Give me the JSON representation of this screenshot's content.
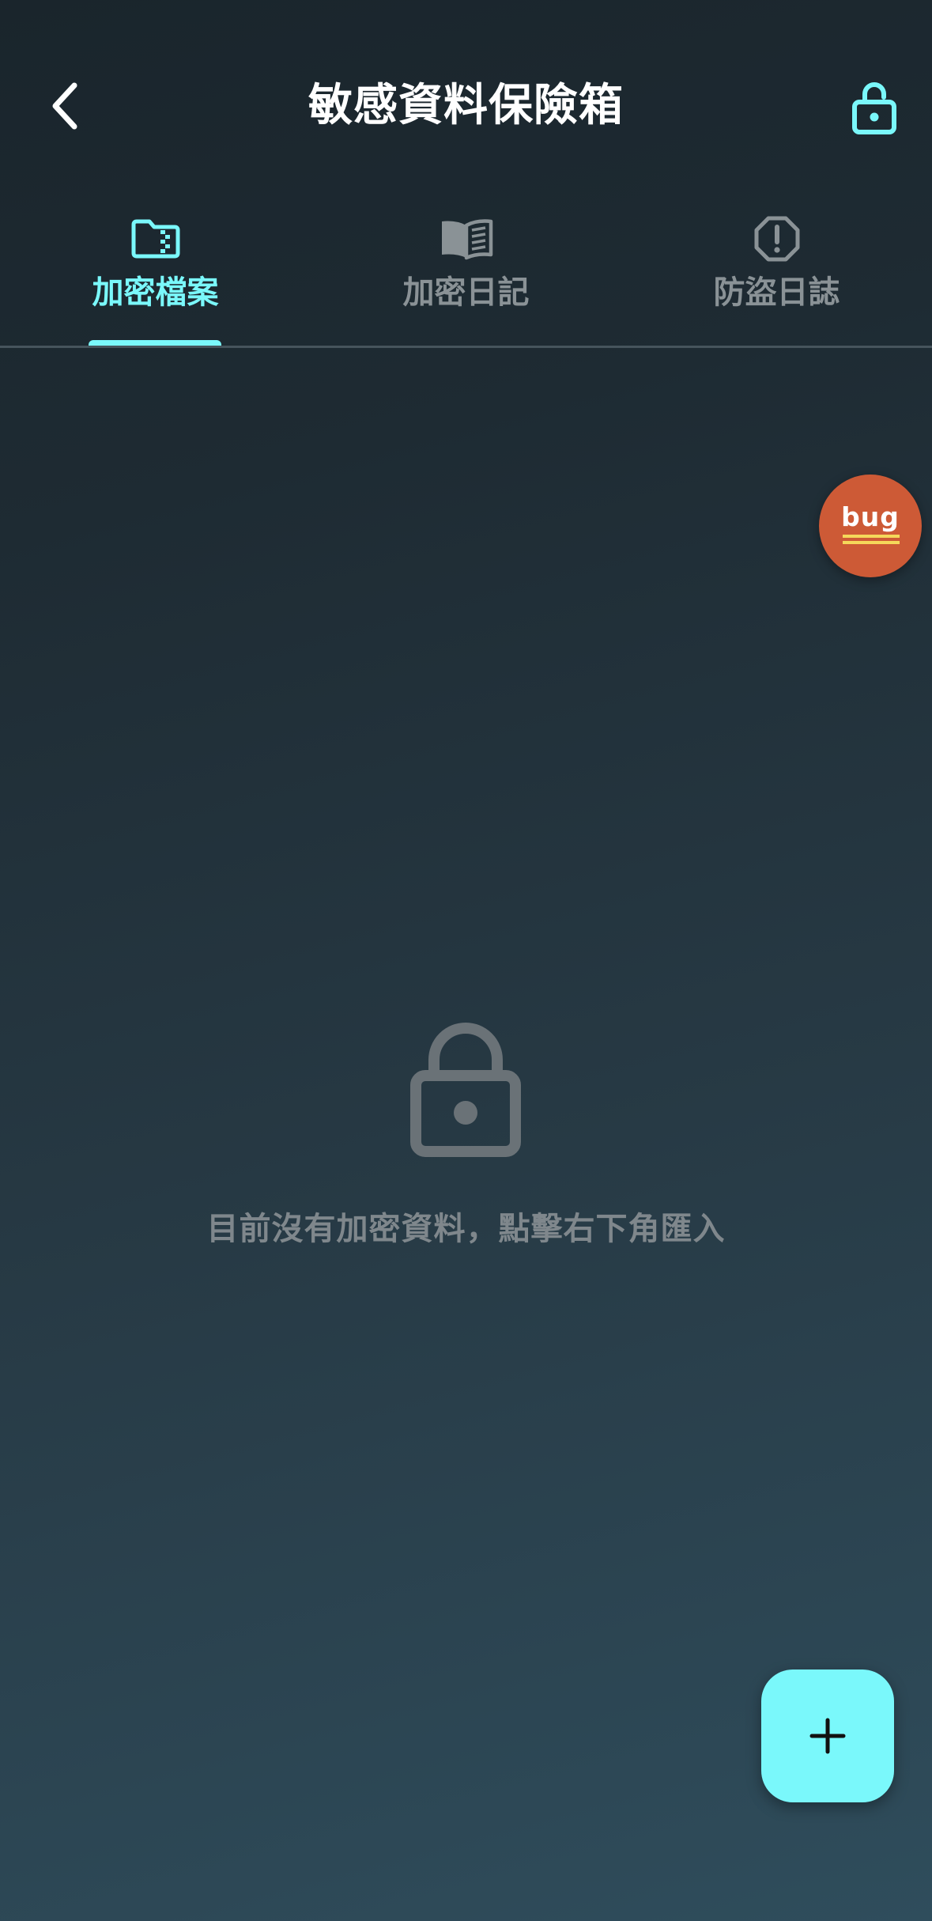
{
  "header": {
    "title": "敏感資料保險箱",
    "back_icon": "chevron-left-icon",
    "lock_icon": "lock-open-icon"
  },
  "tabs": [
    {
      "label": "加密檔案",
      "icon": "folder-zip-icon",
      "active": true
    },
    {
      "label": "加密日記",
      "icon": "book-open-icon",
      "active": false
    },
    {
      "label": "防盜日誌",
      "icon": "alert-octagon-icon",
      "active": false
    }
  ],
  "debug_button": {
    "label": "bug"
  },
  "empty_state": {
    "icon": "lock-icon",
    "message": "目前沒有加密資料，點擊右下角匯入"
  },
  "fab": {
    "icon": "plus-icon"
  },
  "colors": {
    "accent": "#7af8fb",
    "inactive": "#8a9296",
    "debug": "#cd5a36",
    "background_top": "#1a252c",
    "background_bottom": "#2f4d5c"
  }
}
